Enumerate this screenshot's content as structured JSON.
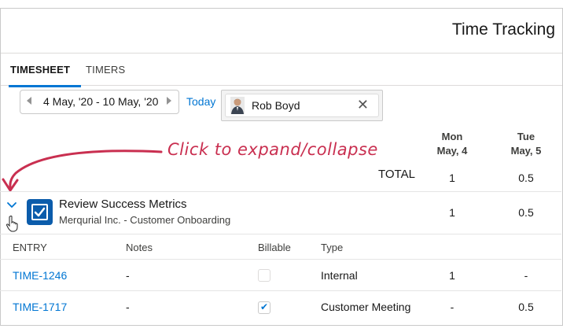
{
  "header": {
    "title": "Time Tracking"
  },
  "tabs": [
    {
      "label": "TIMESHEET",
      "active": true
    },
    {
      "label": "TIMERS",
      "active": false
    }
  ],
  "toolbar": {
    "date_range": "4 May, '20 - 10 May, '20",
    "today_label": "Today",
    "user_name": "Rob Boyd"
  },
  "days": [
    {
      "dow": "Mon",
      "date": "May, 4"
    },
    {
      "dow": "Tue",
      "date": "May, 5"
    }
  ],
  "annotation": {
    "text": "Click to expand/collapse"
  },
  "totals": {
    "label": "TOTAL",
    "values": [
      "1",
      "0.5"
    ]
  },
  "task": {
    "title": "Review Success Metrics",
    "subtitle": "Merqurial Inc. - Customer Onboarding",
    "values": [
      "1",
      "0.5"
    ]
  },
  "entry_columns": {
    "entry": "ENTRY",
    "notes": "Notes",
    "billable": "Billable",
    "type": "Type"
  },
  "entries": [
    {
      "id": "TIME-1246",
      "notes": "-",
      "billable": false,
      "type": "Internal",
      "values": [
        "1",
        "-"
      ]
    },
    {
      "id": "TIME-1717",
      "notes": "-",
      "billable": true,
      "type": "Customer Meeting",
      "values": [
        "-",
        "0.5"
      ]
    }
  ],
  "colors": {
    "accent": "#0176d3",
    "annotation": "#c92f50",
    "task_icon": "#0b5cab"
  },
  "icons": [
    "chevron-left-icon",
    "chevron-right-icon",
    "close-icon",
    "chevron-down-icon",
    "hand-cursor-icon",
    "task-checkbox-icon",
    "check-icon"
  ]
}
